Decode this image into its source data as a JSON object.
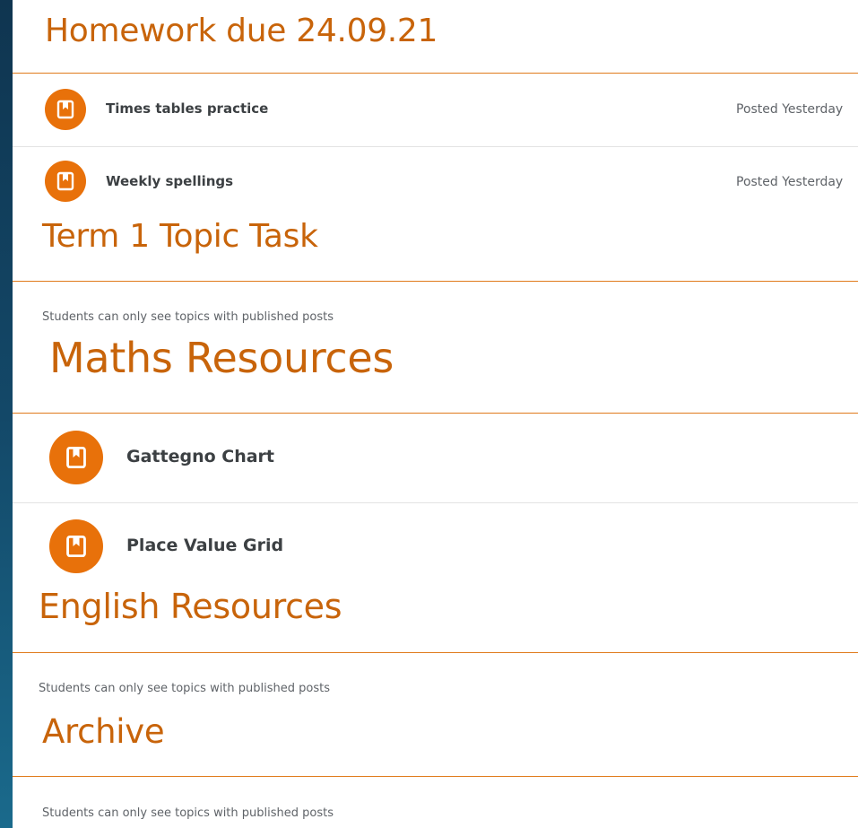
{
  "colors": {
    "accent": "#c8640a",
    "icon_bg": "#e8710a",
    "divider": "#e07b1c",
    "background_outer": "#134868"
  },
  "topics": [
    {
      "title": "Homework due 24.09.21",
      "items": [
        {
          "title": "Times tables practice",
          "posted": "Posted Yesterday",
          "icon": "assignment-icon"
        },
        {
          "title": "Weekly spellings",
          "posted": "Posted Yesterday",
          "icon": "assignment-icon"
        }
      ]
    },
    {
      "title": "Term 1 Topic Task",
      "note": "Students can only see topics with published posts"
    },
    {
      "title": "Maths Resources",
      "items": [
        {
          "title": "Gattegno Chart",
          "icon": "assignment-icon"
        },
        {
          "title": "Place Value Grid",
          "icon": "assignment-icon"
        }
      ]
    },
    {
      "title": "English Resources",
      "note": "Students can only see topics with published posts"
    },
    {
      "title": "Archive",
      "note": "Students can only see topics with published posts"
    }
  ]
}
